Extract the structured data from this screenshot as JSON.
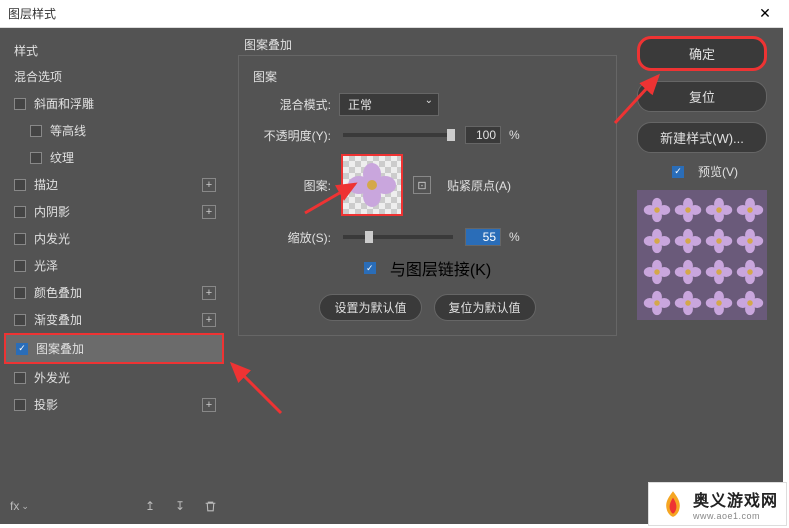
{
  "window": {
    "title": "图层样式"
  },
  "sidebar": {
    "header": "样式",
    "items": [
      {
        "label": "混合选项"
      },
      {
        "label": "斜面和浮雕"
      },
      {
        "label": "等高线"
      },
      {
        "label": "纹理"
      },
      {
        "label": "描边"
      },
      {
        "label": "内阴影"
      },
      {
        "label": "内发光"
      },
      {
        "label": "光泽"
      },
      {
        "label": "颜色叠加"
      },
      {
        "label": "渐变叠加"
      },
      {
        "label": "图案叠加"
      },
      {
        "label": "外发光"
      },
      {
        "label": "投影"
      }
    ]
  },
  "pattern": {
    "group_title": "图案叠加",
    "box_title": "图案",
    "blend_label": "混合模式:",
    "blend_value": "正常",
    "opacity_label": "不透明度(Y):",
    "opacity_value": "100",
    "opacity_unit": "%",
    "pattern_label": "图案:",
    "snap_label": "贴紧原点(A)",
    "scale_label": "缩放(S):",
    "scale_value": "55",
    "scale_unit": "%",
    "link_label": "与图层链接(K)",
    "reset_default": "设置为默认值",
    "restore_default": "复位为默认值"
  },
  "actions": {
    "ok": "确定",
    "reset": "复位",
    "new_style": "新建样式(W)...",
    "preview": "预览(V)"
  },
  "watermark": {
    "main": "奥义游戏网",
    "sub": "www.aoe1.com"
  },
  "footer": {
    "fx": "fx"
  }
}
